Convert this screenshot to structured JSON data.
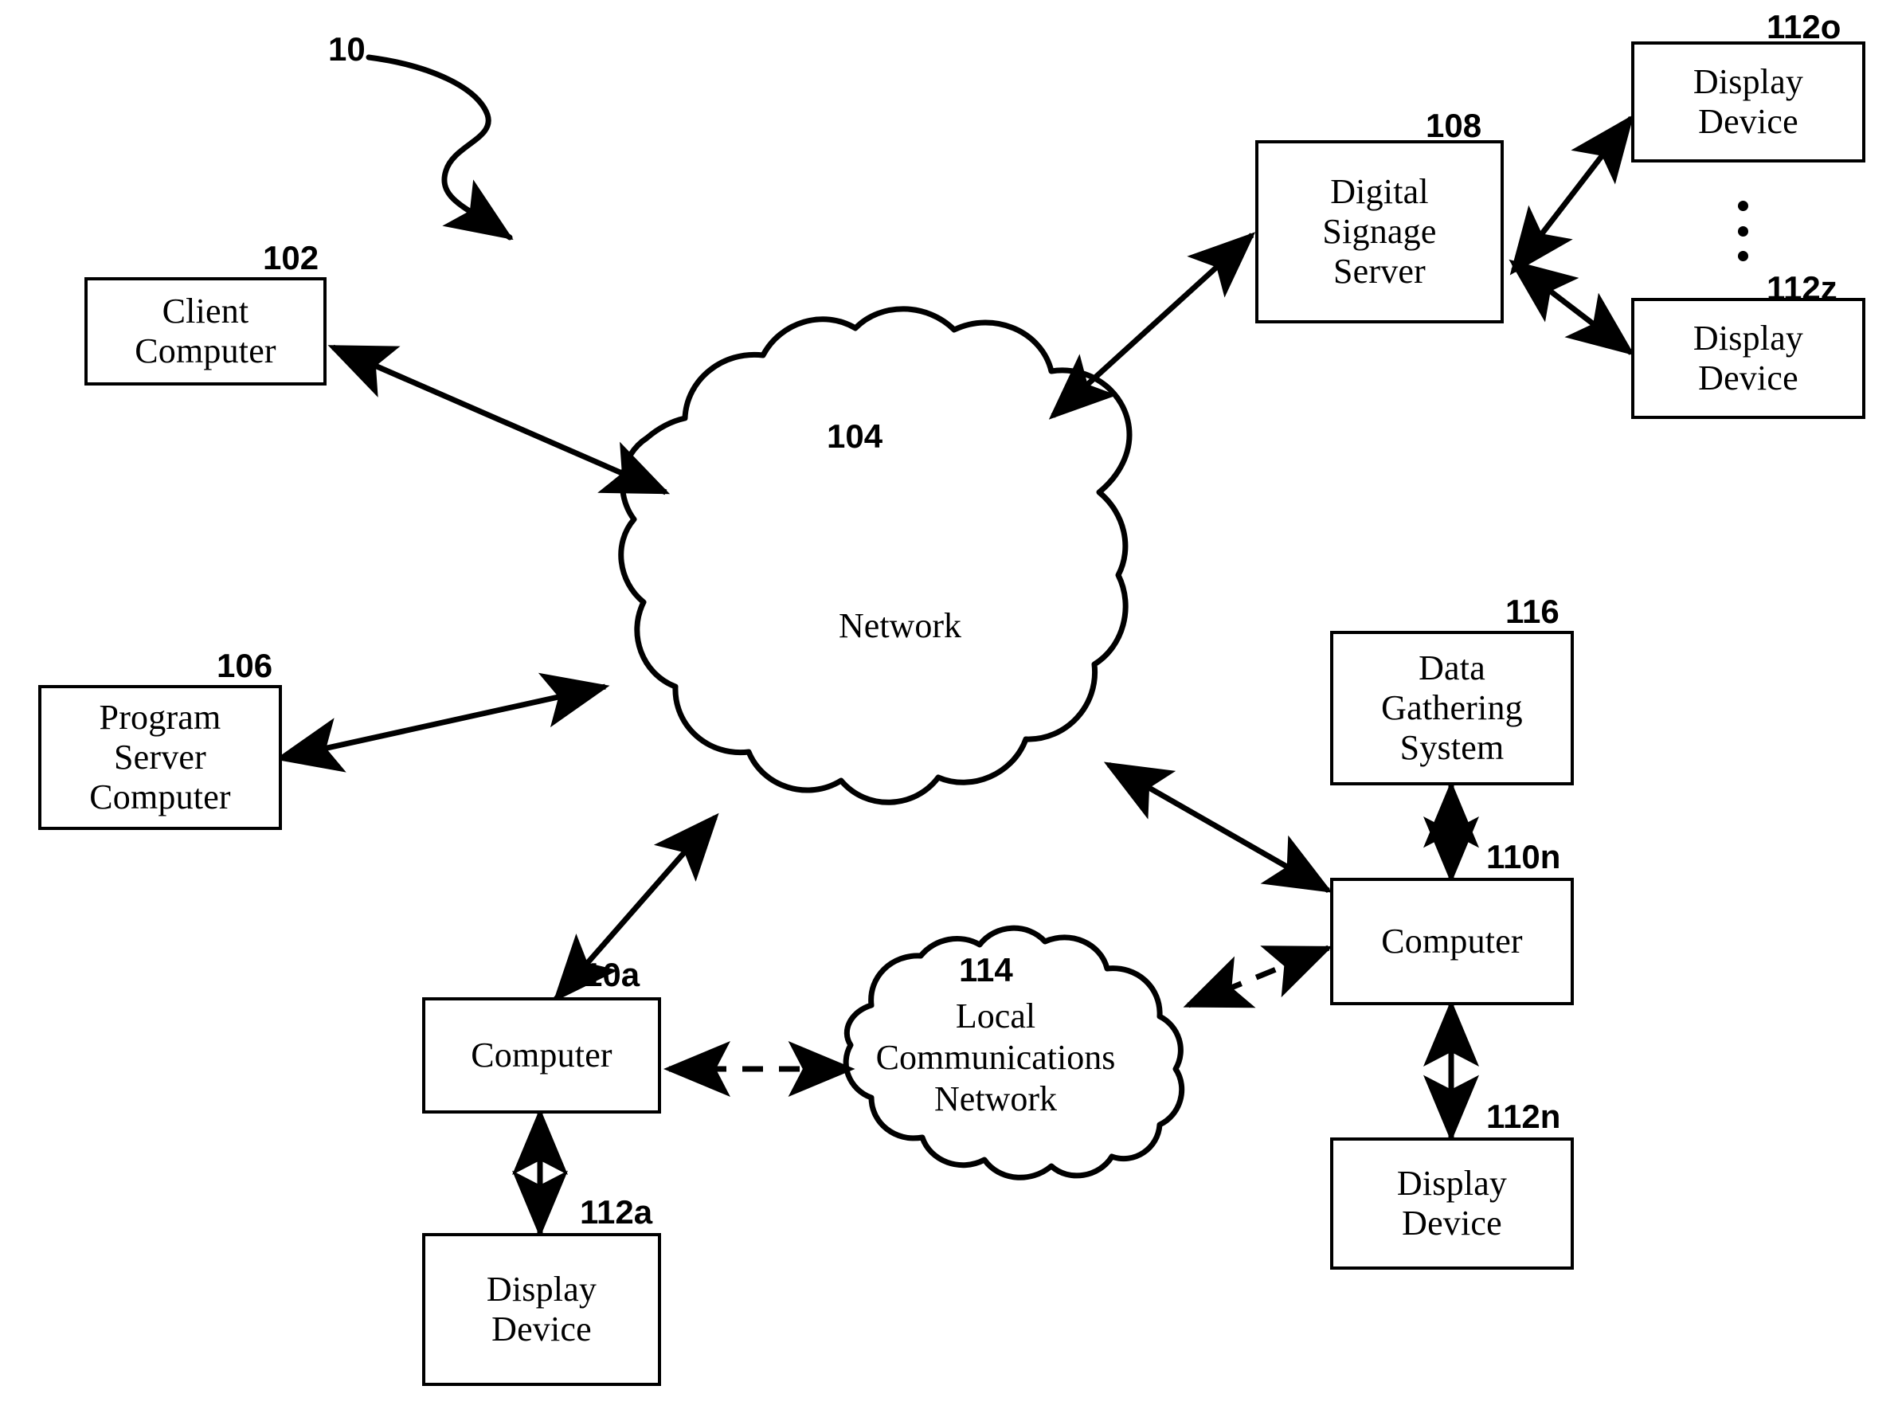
{
  "figure": {
    "figure_ref": "10",
    "nodes": [
      {
        "id": "client_computer",
        "ref": "102",
        "label": "Client\nComputer"
      },
      {
        "id": "network",
        "ref": "104",
        "label": "Network"
      },
      {
        "id": "program_server",
        "ref": "106",
        "label": "Program\nServer\nComputer"
      },
      {
        "id": "signage_server",
        "ref": "108",
        "label": "Digital\nSignage\nServer"
      },
      {
        "id": "computer_110a",
        "ref": "110a",
        "label": "Computer"
      },
      {
        "id": "computer_110n",
        "ref": "110n",
        "label": "Computer"
      },
      {
        "id": "display_112a",
        "ref": "112a",
        "label": "Display\nDevice"
      },
      {
        "id": "display_112n",
        "ref": "112n",
        "label": "Display\nDevice"
      },
      {
        "id": "display_112o",
        "ref": "112o",
        "label": "Display\nDevice"
      },
      {
        "id": "display_112z",
        "ref": "112z",
        "label": "Display\nDevice"
      },
      {
        "id": "local_comm_network",
        "ref": "114",
        "label": "Local\nCommunications\nNetwork"
      },
      {
        "id": "data_gathering",
        "ref": "116",
        "label": "Data\nGathering\nSystem"
      }
    ],
    "connections": [
      {
        "from": "client_computer",
        "to": "network",
        "style": "solid",
        "arrows": "both"
      },
      {
        "from": "program_server",
        "to": "network",
        "style": "solid",
        "arrows": "both"
      },
      {
        "from": "network",
        "to": "signage_server",
        "style": "solid",
        "arrows": "both"
      },
      {
        "from": "signage_server",
        "to": "display_112o",
        "style": "solid",
        "arrows": "both"
      },
      {
        "from": "signage_server",
        "to": "display_112z",
        "style": "solid",
        "arrows": "both"
      },
      {
        "from": "network",
        "to": "computer_110a",
        "style": "solid",
        "arrows": "both"
      },
      {
        "from": "network",
        "to": "computer_110n",
        "style": "solid",
        "arrows": "both"
      },
      {
        "from": "computer_110a",
        "to": "display_112a",
        "style": "solid",
        "arrows": "both"
      },
      {
        "from": "computer_110n",
        "to": "display_112n",
        "style": "solid",
        "arrows": "both"
      },
      {
        "from": "computer_110n",
        "to": "data_gathering",
        "style": "solid",
        "arrows": "both"
      },
      {
        "from": "computer_110a",
        "to": "local_comm_network",
        "style": "dashed",
        "arrows": "both"
      },
      {
        "from": "local_comm_network",
        "to": "computer_110n",
        "style": "dashed",
        "arrows": "both"
      }
    ],
    "colors": {
      "line": "#000000",
      "background": "#ffffff",
      "text": "#000000"
    }
  }
}
